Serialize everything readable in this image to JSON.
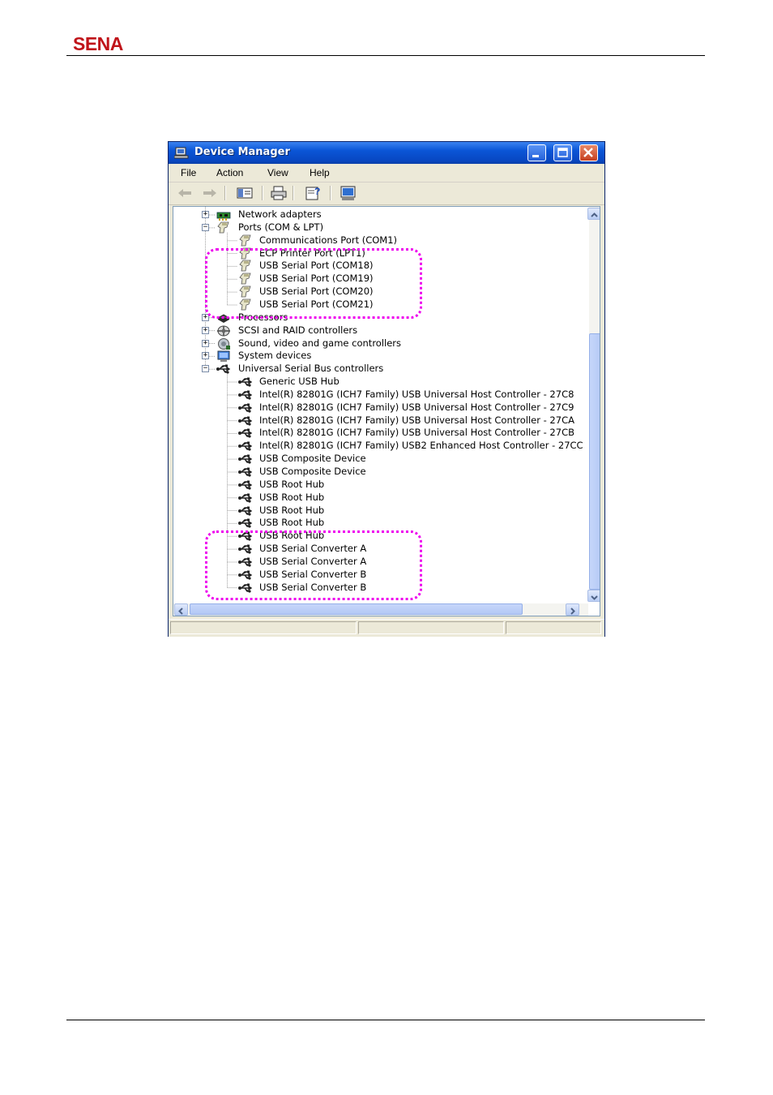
{
  "header": {
    "logo": "SENA"
  },
  "window": {
    "title": "Device Manager",
    "menu": [
      "File",
      "Action",
      "View",
      "Help"
    ],
    "tree": [
      {
        "label": "Network adapters",
        "level": 1,
        "expander": "+",
        "icon": "network-adapter-icon"
      },
      {
        "label": "Ports (COM & LPT)",
        "level": 1,
        "expander": "-",
        "icon": "port-connector-icon"
      },
      {
        "label": "Communications Port (COM1)",
        "level": 2,
        "icon": "port-connector-icon"
      },
      {
        "label": "ECP Printer Port (LPT1)",
        "level": 2,
        "icon": "port-connector-icon"
      },
      {
        "label": "USB Serial Port (COM18)",
        "level": 2,
        "icon": "port-connector-icon"
      },
      {
        "label": "USB Serial Port (COM19)",
        "level": 2,
        "icon": "port-connector-icon"
      },
      {
        "label": "USB Serial Port (COM20)",
        "level": 2,
        "icon": "port-connector-icon"
      },
      {
        "label": "USB Serial Port (COM21)",
        "level": 2,
        "icon": "port-connector-icon"
      },
      {
        "label": "Processors",
        "level": 1,
        "expander": "+",
        "icon": "processor-icon"
      },
      {
        "label": "SCSI and RAID controllers",
        "level": 1,
        "expander": "+",
        "icon": "scsi-controller-icon"
      },
      {
        "label": "Sound, video and game controllers",
        "level": 1,
        "expander": "+",
        "icon": "sound-controller-icon"
      },
      {
        "label": "System devices",
        "level": 1,
        "expander": "+",
        "icon": "system-device-icon"
      },
      {
        "label": "Universal Serial Bus controllers",
        "level": 1,
        "expander": "-",
        "icon": "usb-icon"
      },
      {
        "label": "Generic USB Hub",
        "level": 2,
        "icon": "usb-icon"
      },
      {
        "label": "Intel(R) 82801G (ICH7 Family) USB Universal Host Controller - 27C8",
        "level": 2,
        "icon": "usb-icon"
      },
      {
        "label": "Intel(R) 82801G (ICH7 Family) USB Universal Host Controller - 27C9",
        "level": 2,
        "icon": "usb-icon"
      },
      {
        "label": "Intel(R) 82801G (ICH7 Family) USB Universal Host Controller - 27CA",
        "level": 2,
        "icon": "usb-icon"
      },
      {
        "label": "Intel(R) 82801G (ICH7 Family) USB Universal Host Controller - 27CB",
        "level": 2,
        "icon": "usb-icon"
      },
      {
        "label": "Intel(R) 82801G (ICH7 Family) USB2 Enhanced Host Controller - 27CC",
        "level": 2,
        "icon": "usb-icon"
      },
      {
        "label": "USB Composite Device",
        "level": 2,
        "icon": "usb-icon"
      },
      {
        "label": "USB Composite Device",
        "level": 2,
        "icon": "usb-icon"
      },
      {
        "label": "USB Root Hub",
        "level": 2,
        "icon": "usb-icon"
      },
      {
        "label": "USB Root Hub",
        "level": 2,
        "icon": "usb-icon"
      },
      {
        "label": "USB Root Hub",
        "level": 2,
        "icon": "usb-icon"
      },
      {
        "label": "USB Root Hub",
        "level": 2,
        "icon": "usb-icon"
      },
      {
        "label": "USB Root Hub",
        "level": 2,
        "icon": "usb-icon"
      },
      {
        "label": "USB Serial Converter A",
        "level": 2,
        "icon": "usb-icon"
      },
      {
        "label": "USB Serial Converter A",
        "level": 2,
        "icon": "usb-icon"
      },
      {
        "label": "USB Serial Converter B",
        "level": 2,
        "icon": "usb-icon"
      },
      {
        "label": "USB Serial Converter B",
        "level": 2,
        "icon": "usb-icon"
      }
    ],
    "highlight_color": "#ee00ee"
  }
}
